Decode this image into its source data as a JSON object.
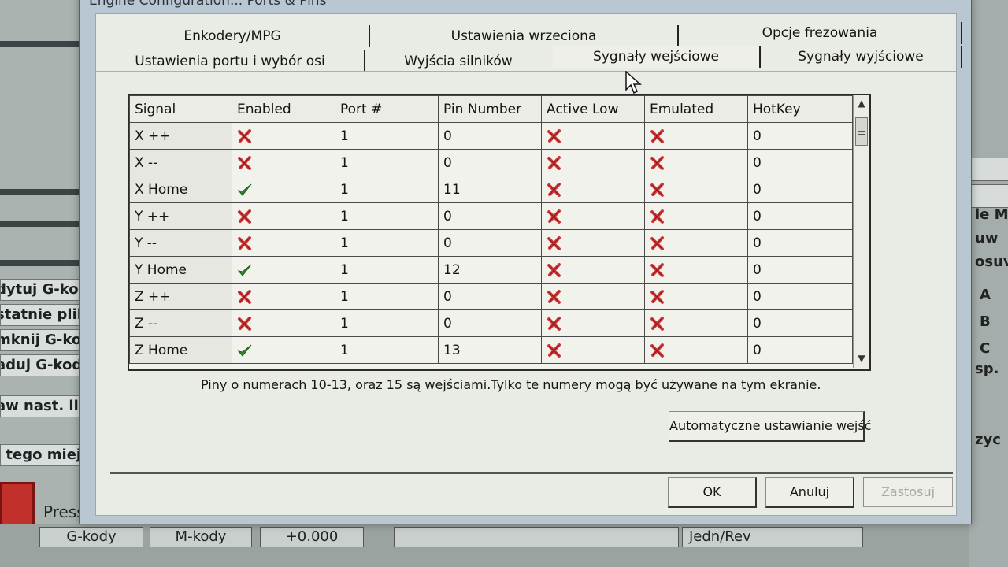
{
  "window": {
    "title": "Engine Configuration... Ports & Pins"
  },
  "tabs_row1": [
    {
      "label": "Enkodery/MPG"
    },
    {
      "label": "Ustawienia wrzeciona"
    },
    {
      "label": "Opcje frezowania"
    }
  ],
  "tabs_row2": [
    {
      "label": "Ustawienia portu i wybór osi"
    },
    {
      "label": "Wyjścia silników"
    },
    {
      "label": "Sygnały wejściowe"
    },
    {
      "label": "Sygnały wyjściowe"
    }
  ],
  "table": {
    "columns": [
      "Signal",
      "Enabled",
      "Port #",
      "Pin Number",
      "Active Low",
      "Emulated",
      "HotKey"
    ],
    "rows": [
      {
        "signal": "X ++",
        "enabled": false,
        "port": "1",
        "pin": "0",
        "active_low": false,
        "emulated": false,
        "hotkey": "0"
      },
      {
        "signal": "X --",
        "enabled": false,
        "port": "1",
        "pin": "0",
        "active_low": false,
        "emulated": false,
        "hotkey": "0"
      },
      {
        "signal": "X Home",
        "enabled": true,
        "port": "1",
        "pin": "11",
        "active_low": false,
        "emulated": false,
        "hotkey": "0"
      },
      {
        "signal": "Y ++",
        "enabled": false,
        "port": "1",
        "pin": "0",
        "active_low": false,
        "emulated": false,
        "hotkey": "0"
      },
      {
        "signal": "Y --",
        "enabled": false,
        "port": "1",
        "pin": "0",
        "active_low": false,
        "emulated": false,
        "hotkey": "0"
      },
      {
        "signal": "Y Home",
        "enabled": true,
        "port": "1",
        "pin": "12",
        "active_low": false,
        "emulated": false,
        "hotkey": "0"
      },
      {
        "signal": "Z ++",
        "enabled": false,
        "port": "1",
        "pin": "0",
        "active_low": false,
        "emulated": false,
        "hotkey": "0"
      },
      {
        "signal": "Z --",
        "enabled": false,
        "port": "1",
        "pin": "0",
        "active_low": false,
        "emulated": false,
        "hotkey": "0"
      },
      {
        "signal": "Z Home",
        "enabled": true,
        "port": "1",
        "pin": "13",
        "active_low": false,
        "emulated": false,
        "hotkey": "0"
      }
    ]
  },
  "info_text": "Piny o numerach 10-13, oraz 15 są wejściami.Tylko te numery mogą być używane na tym ekranie.",
  "buttons": {
    "auto": "Automatyczne ustawianie wejść",
    "ok": "OK",
    "cancel": "Anuluj",
    "apply": "Zastosuj"
  },
  "background": {
    "left_buttons": [
      "dytuj G-kod",
      "statnie pliki",
      "mknij G-kod",
      "aduj G-kod",
      "aw nast. lin",
      "i tego miejsc"
    ],
    "press_label": "Press",
    "bottom_cells": [
      "G-kody",
      "M-kody",
      "+0.000",
      "Jedn/Rev"
    ],
    "right_labels": [
      "le M",
      "uw",
      "osuv",
      "A",
      "B",
      "C",
      "sp.",
      "zyc"
    ]
  },
  "colors": {
    "check": "#2e8a2a",
    "cross": "#d23a3a"
  }
}
